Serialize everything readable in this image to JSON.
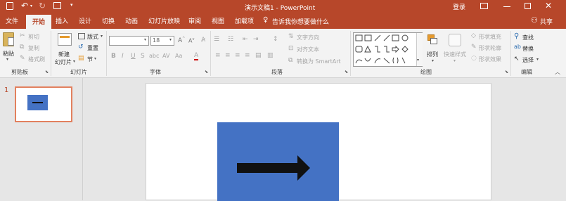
{
  "title_bar": {
    "document_title": "演示文稿1 - PowerPoint",
    "login_label": "登录"
  },
  "tabs": [
    "文件",
    "开始",
    "插入",
    "设计",
    "切换",
    "动画",
    "幻灯片放映",
    "审阅",
    "视图",
    "加载项"
  ],
  "tell_me": "告诉我你想要做什么",
  "share_label": "共享",
  "ribbon": {
    "clipboard": {
      "paste": "粘贴",
      "cut": "剪切",
      "copy": "复制",
      "format_painter": "格式刷",
      "group_label": "剪贴板"
    },
    "slides": {
      "new_slide_line1": "新建",
      "new_slide_line2": "幻灯片",
      "layout": "版式",
      "reset": "重置",
      "section": "节",
      "group_label": "幻灯片"
    },
    "font": {
      "size": "18",
      "group_label": "字体"
    },
    "paragraph": {
      "text_direction": "文字方向",
      "align_text": "对齐文本",
      "convert_smartart": "转换为 SmartArt",
      "group_label": "段落"
    },
    "drawing": {
      "arrange": "排列",
      "quick_styles": "快速样式",
      "shape_fill": "形状填充",
      "shape_outline": "形状轮廓",
      "shape_effects": "形状效果",
      "group_label": "绘图"
    },
    "editing": {
      "find": "查找",
      "replace": "替换",
      "select": "选择",
      "group_label": "编辑"
    }
  },
  "slides_pane": {
    "slide_number": "1"
  },
  "colors": {
    "accent": "#b7472a",
    "shape_fill": "#4472c4",
    "arrow": "#111111"
  }
}
